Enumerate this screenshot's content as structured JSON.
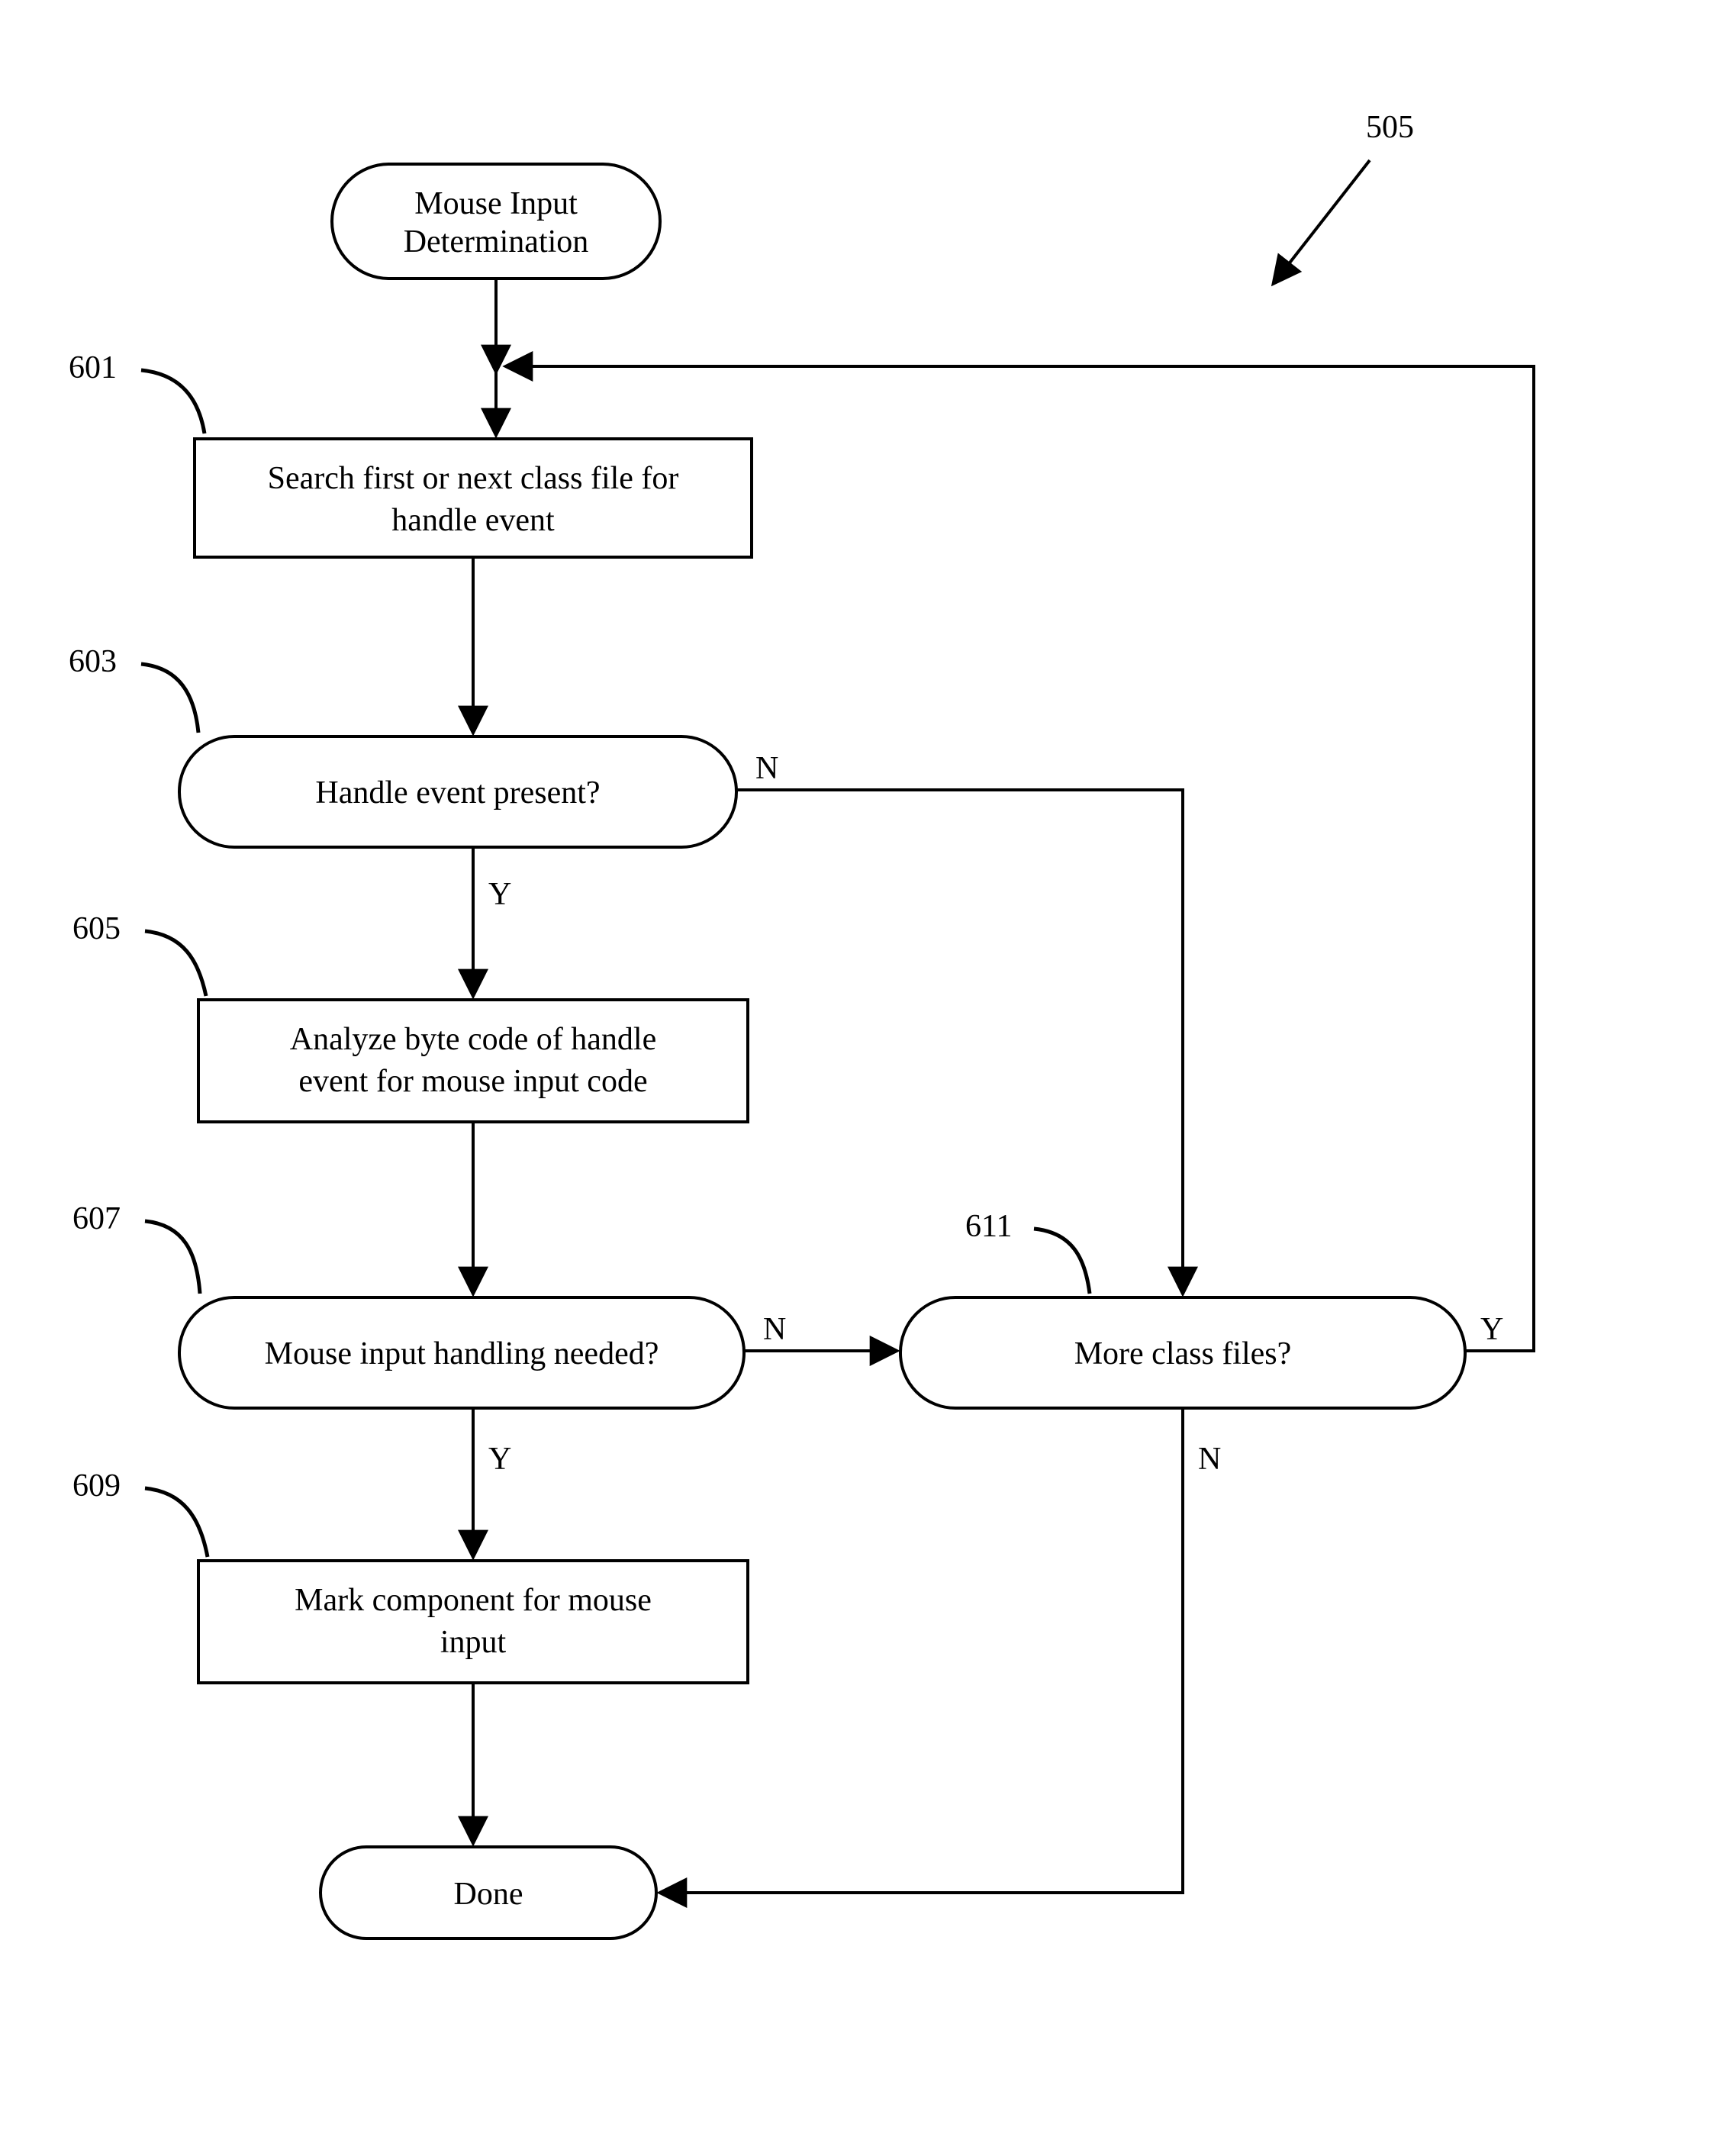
{
  "ref_main": "505",
  "labels": {
    "n601": "601",
    "n603": "603",
    "n605": "605",
    "n607": "607",
    "n609": "609",
    "n611": "611"
  },
  "nodes": {
    "start_l1": "Mouse Input",
    "start_l2": "Determination",
    "n601_l1": "Search first or next class file for",
    "n601_l2": "handle event",
    "n603": "Handle event present?",
    "n605_l1": "Analyze byte code of handle",
    "n605_l2": "event for mouse input code",
    "n607": "Mouse input handling needed?",
    "n609_l1": "Mark component for mouse",
    "n609_l2": "input",
    "n611": "More class files?",
    "done": "Done"
  },
  "yn": {
    "y603": "Y",
    "n603": "N",
    "y607": "Y",
    "n607": "N",
    "y611": "Y",
    "n611": "N"
  }
}
